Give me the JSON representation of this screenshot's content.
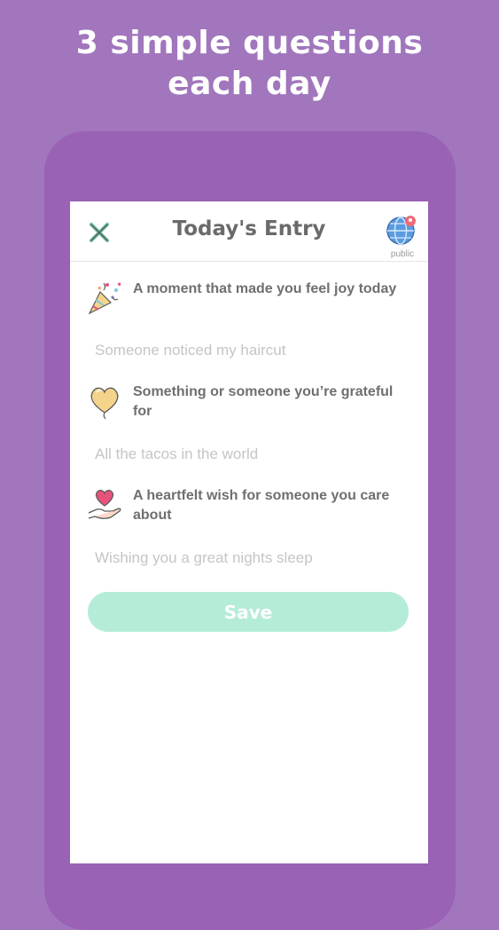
{
  "promo": {
    "headline_line1": "3 simple questions",
    "headline_line2": "each day"
  },
  "header": {
    "title": "Today's Entry",
    "close_icon": "close-x-icon",
    "visibility_icon": "globe-icon",
    "visibility_label": "public"
  },
  "questions": [
    {
      "icon": "party-popper-icon",
      "prompt": "A moment that made you feel joy today",
      "placeholder": "Someone noticed my haircut"
    },
    {
      "icon": "heart-balloon-icon",
      "prompt": "Something or someone you’re grateful for",
      "placeholder": "All the tacos in the world"
    },
    {
      "icon": "heart-in-hand-icon",
      "prompt": "A heartfelt wish for someone you care about",
      "placeholder": "Wishing you a great nights sleep"
    }
  ],
  "save_label": "Save",
  "colors": {
    "background": "#a176bd",
    "phone_frame": "#9962b5",
    "save_button": "#b5ecd8",
    "close_icon": "#6fb8a3",
    "heart": "#e8527a"
  }
}
